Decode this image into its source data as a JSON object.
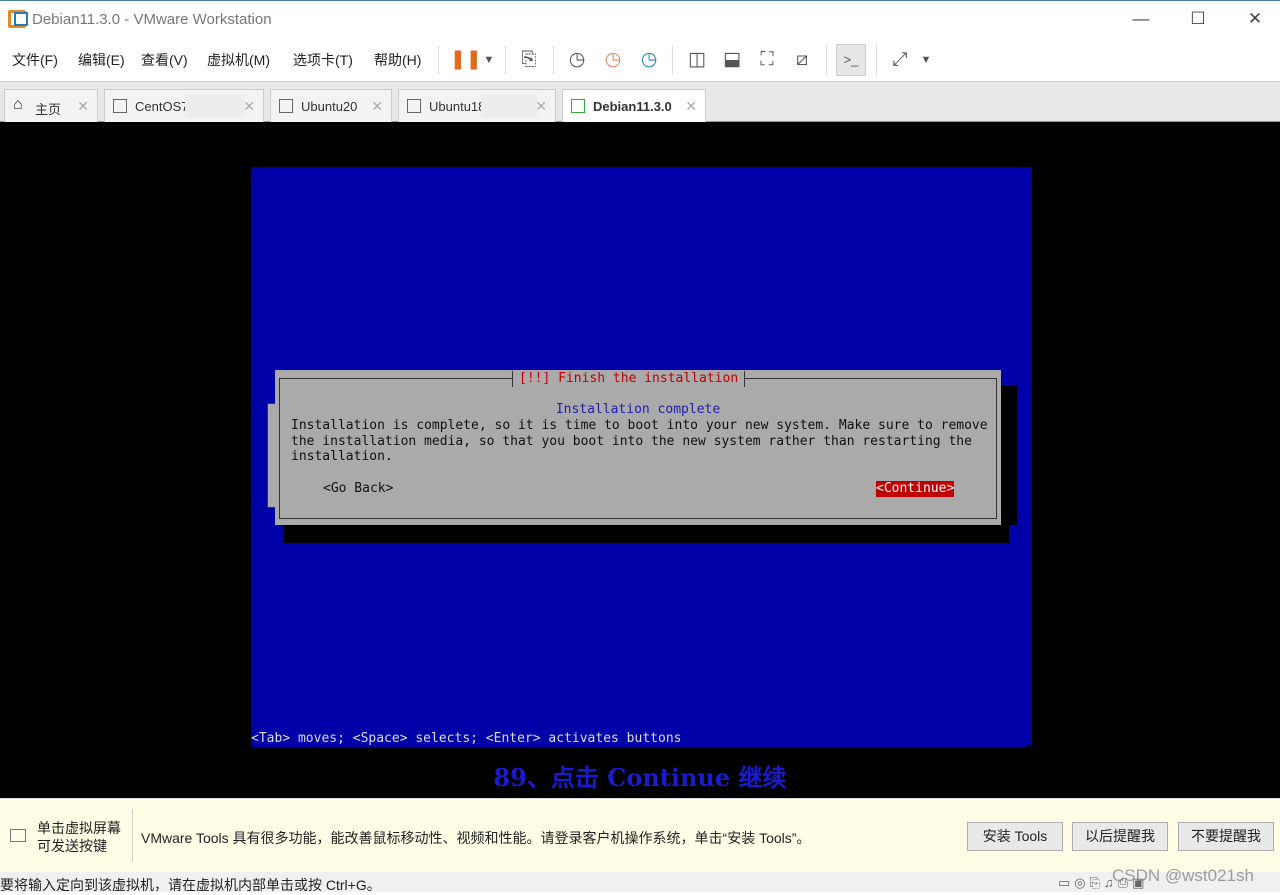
{
  "window": {
    "title": "Debian11.3.0 - VMware Workstation"
  },
  "menu": [
    "文件(F)",
    "编辑(E)",
    "查看(V)",
    "虚拟机(M)",
    "选项卡(T)",
    "帮助(H)"
  ],
  "tabs": [
    {
      "label": "主页"
    },
    {
      "label": "CentOS7"
    },
    {
      "label": "Ubuntu20"
    },
    {
      "label": "Ubuntu18"
    },
    {
      "label": "Debian11.3.0"
    }
  ],
  "installer": {
    "dialog_title": "[!!] Finish the installation",
    "heading": "Installation complete",
    "body": "Installation is complete, so it is time to boot into your new system. Make sure to remove\nthe installation media, so that you boot into the new system rather than restarting the\ninstallation.",
    "go_back": "<Go Back>",
    "continue": "<Continue>",
    "help_line": "<Tab> moves; <Space> selects; <Enter> activates buttons"
  },
  "caption": "89、点击 Continue 继续",
  "notification": {
    "hint": "单击虚拟屏幕\n可发送按键",
    "message": "VMware Tools 具有很多功能，能改善鼠标移动性、视频和性能。请登录客户机操作系统，单击“安装 Tools”。",
    "install": "安装 Tools",
    "later": "以后提醒我",
    "never": "不要提醒我"
  },
  "status": {
    "text": "要将输入定向到该虚拟机，请在虚拟机内部单击或按 Ctrl+G。",
    "watermark": "CSDN @wst021sh"
  },
  "colors": {
    "installer_bg": "#0000a8",
    "dialog_bg": "#aaaaaa",
    "accent_red": "#c00000"
  }
}
